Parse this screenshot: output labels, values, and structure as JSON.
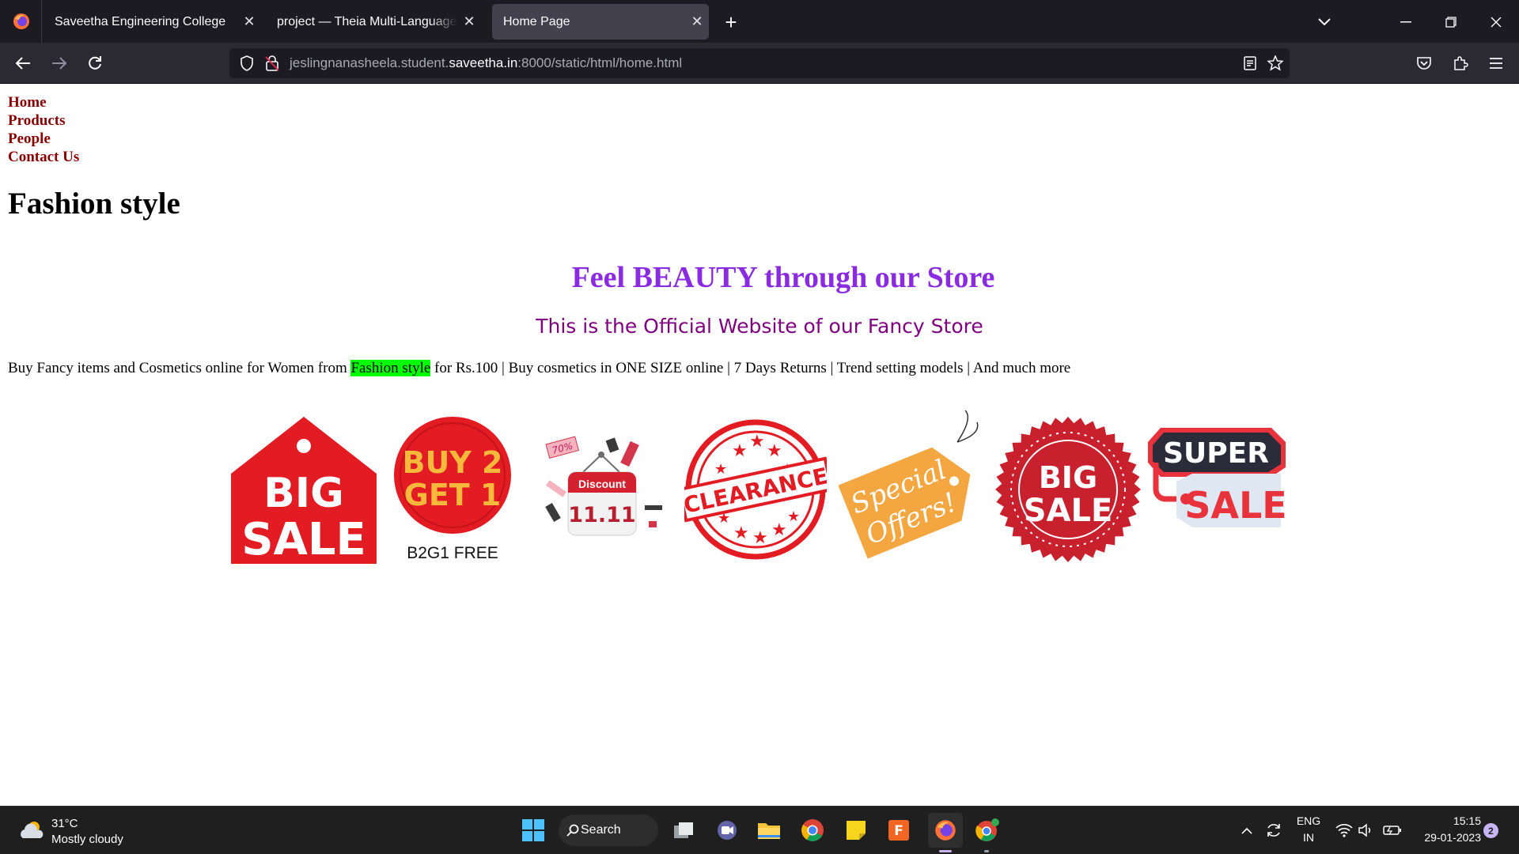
{
  "browser": {
    "tabs": [
      {
        "title": "Saveetha Engineering College",
        "active": false
      },
      {
        "title": "project — Theia Multi-Language Ex",
        "active": false
      },
      {
        "title": "Home Page",
        "active": true
      }
    ],
    "url_prefix": "jeslingnanasheela.student.",
    "url_host": "saveetha.in",
    "url_suffix": ":8000/static/html/home.html"
  },
  "page": {
    "nav": [
      "Home",
      "Products",
      "People",
      "Contact Us"
    ],
    "heading": "Fashion style",
    "tagline": "Feel BEAUTY through our Store",
    "subtagline": "This is the Official Website of our Fancy Store",
    "desc_before": "Buy Fancy items and Cosmetics online for Women from ",
    "desc_highlight": "Fashion style",
    "desc_after": " for Rs.100 | Buy cosmetics in ONE SIZE online | 7 Days Returns | Trend setting models | And much more",
    "banners": {
      "big_sale_tag": [
        "BIG",
        "SALE"
      ],
      "buy2get1": [
        "BUY 2",
        "GET 1",
        "B2G1 FREE"
      ],
      "discount": [
        "Discount",
        "11.11",
        "70%"
      ],
      "clearance": "CLEARANCE",
      "special": [
        "Special",
        "Offers!"
      ],
      "big_sale_seal": [
        "BIG",
        "SALE"
      ],
      "super_sale": [
        "SUPER",
        "SALE"
      ]
    }
  },
  "taskbar": {
    "temperature": "31°C",
    "weather": "Mostly cloudy",
    "search_label": "Search",
    "language": "ENG",
    "region": "IN",
    "time": "15:15",
    "date": "29-01-2023",
    "notifications": "2"
  },
  "colors": {
    "tab_bar": "#1c1b22",
    "toolbar": "#2b2a33",
    "nav_link": "#8b0000",
    "tagline": "#8a2be2",
    "subtagline": "#800080",
    "highlight": "#00ff00",
    "sale_red": "#e31b23"
  }
}
